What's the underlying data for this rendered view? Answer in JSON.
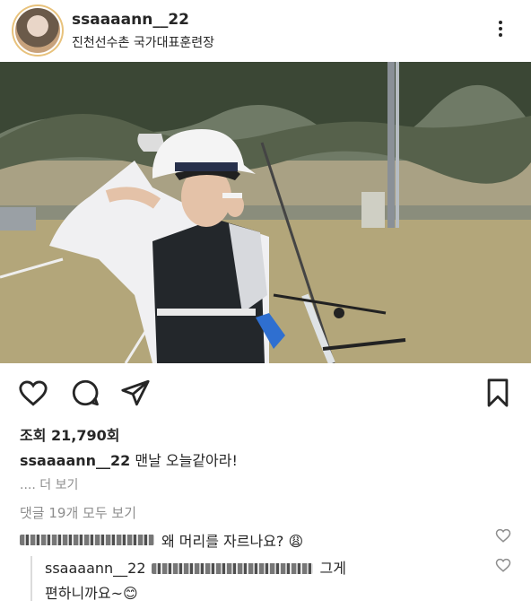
{
  "post": {
    "username": "ssaaaann__22",
    "location": "진천선수촌 국가대표훈련장",
    "views": "조회 21,790회",
    "caption_user": "ssaaaann__22",
    "caption_text": "맨날 오늘같아라!",
    "more_label": ".... 더 보기",
    "view_comments_label": "댓글 19개 모두 보기"
  },
  "comments": [
    {
      "text": "왜 머리를 자르나요? 😩"
    }
  ],
  "reply": {
    "username": "ssaaaann__22",
    "text_part1": "그게",
    "text_part2": "편하니까요~😊"
  },
  "icons": [
    "avatar",
    "more-icon",
    "heart-icon",
    "comment-icon",
    "share-icon",
    "bookmark-icon"
  ]
}
